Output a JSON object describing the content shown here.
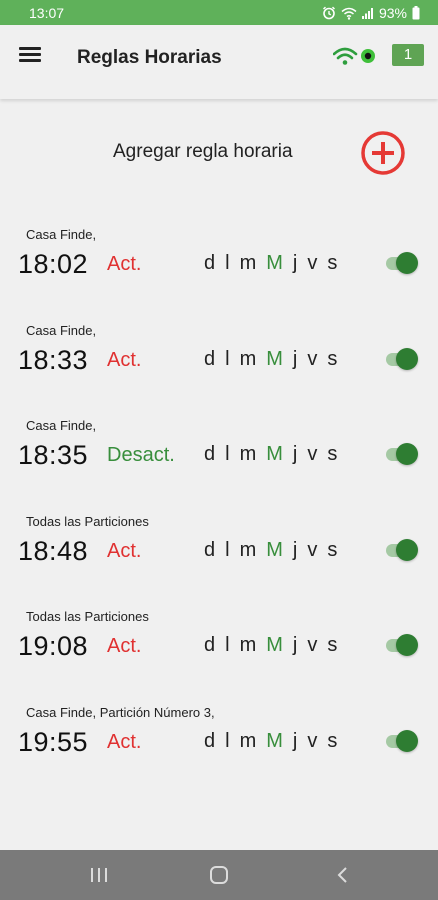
{
  "status_bar": {
    "time": "13:07",
    "battery": "93%"
  },
  "app_bar": {
    "title": "Reglas Horarias",
    "badge_count": "1"
  },
  "add_rule": {
    "label": "Agregar regla horaria"
  },
  "colors": {
    "status_bar": "#5fb15a",
    "badge": "#5fa454",
    "act_red": "#e03131",
    "desact_green": "#388e3c",
    "toggle_on": "#2e7d32",
    "add_button_red": "#e53935"
  },
  "rules": [
    {
      "zone": "Casa Finde,",
      "time": "18:02",
      "action": "Act.",
      "action_type": "act",
      "days": [
        "d",
        "l",
        "m",
        "M",
        "j",
        "v",
        "s"
      ],
      "active_day_index": 3,
      "enabled": true
    },
    {
      "zone": "Casa Finde,",
      "time": "18:33",
      "action": "Act.",
      "action_type": "act",
      "days": [
        "d",
        "l",
        "m",
        "M",
        "j",
        "v",
        "s"
      ],
      "active_day_index": 3,
      "enabled": true
    },
    {
      "zone": "Casa Finde,",
      "time": "18:35",
      "action": "Desact.",
      "action_type": "desact",
      "days": [
        "d",
        "l",
        "m",
        "M",
        "j",
        "v",
        "s"
      ],
      "active_day_index": 3,
      "enabled": true
    },
    {
      "zone": "Todas las Particiones",
      "time": "18:48",
      "action": "Act.",
      "action_type": "act",
      "days": [
        "d",
        "l",
        "m",
        "M",
        "j",
        "v",
        "s"
      ],
      "active_day_index": 3,
      "enabled": true
    },
    {
      "zone": "Todas las Particiones",
      "time": "19:08",
      "action": "Act.",
      "action_type": "act",
      "days": [
        "d",
        "l",
        "m",
        "M",
        "j",
        "v",
        "s"
      ],
      "active_day_index": 3,
      "enabled": true
    },
    {
      "zone": "Casa Finde, Partición Número 3,",
      "time": "19:55",
      "action": "Act.",
      "action_type": "act",
      "days": [
        "d",
        "l",
        "m",
        "M",
        "j",
        "v",
        "s"
      ],
      "active_day_index": 3,
      "enabled": true
    }
  ],
  "nav_bar": {
    "buttons": [
      "recent-apps",
      "home",
      "back"
    ]
  }
}
